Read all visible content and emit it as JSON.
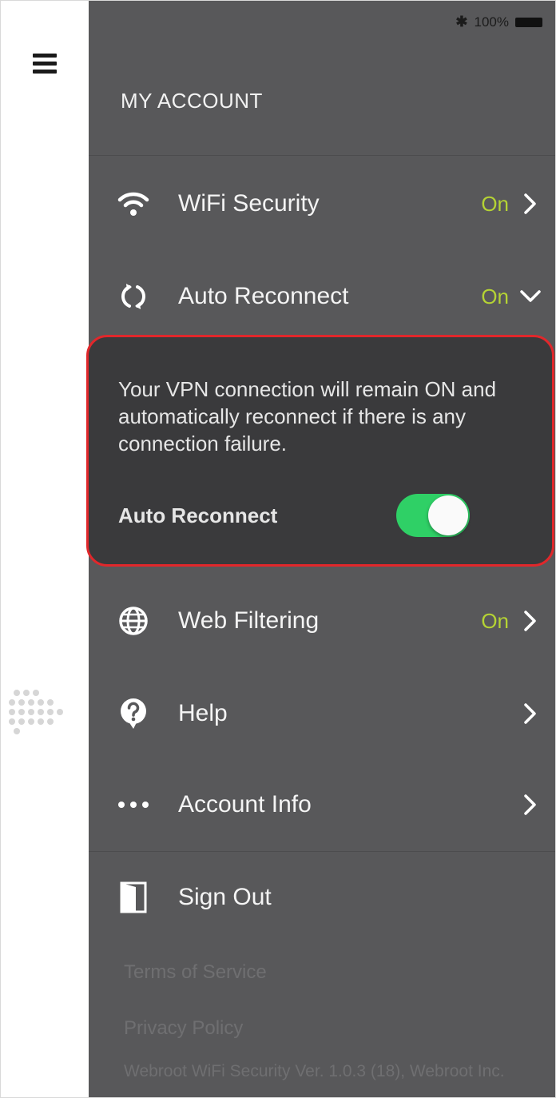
{
  "status_bar": {
    "bluetooth_symbol": "✱",
    "battery_text": "100%"
  },
  "menu": {
    "title": "MY ACCOUNT",
    "items": [
      {
        "icon": "wifi-icon",
        "label": "WiFi Security",
        "value": "On",
        "chevron": "right"
      },
      {
        "icon": "reconnect-icon",
        "label": "Auto Reconnect",
        "value": "On",
        "chevron": "down"
      },
      {
        "icon": "globe-icon",
        "label": "Web Filtering",
        "value": "On",
        "chevron": "right"
      },
      {
        "icon": "help-icon",
        "label": "Help",
        "value": "",
        "chevron": "right"
      },
      {
        "icon": "more-dots-icon",
        "label": "Account Info",
        "value": "",
        "chevron": "right"
      },
      {
        "icon": "sign-out-icon",
        "label": "Sign Out",
        "value": "",
        "chevron": ""
      }
    ]
  },
  "auto_reconnect_panel": {
    "description": "Your VPN connection will remain ON and automatically reconnect if there is any connection failure.",
    "toggle_label": "Auto Reconnect",
    "toggle_on": true
  },
  "footer": {
    "terms": "Terms of Service",
    "privacy": "Privacy Policy",
    "version": "Webroot WiFi Security Ver. 1.0.3 (18), Webroot Inc."
  },
  "colors": {
    "panel_bg": "#58585a",
    "expanded_bg": "#3a3a3c",
    "highlight_border": "#e1272b",
    "value_green": "#b5d334",
    "toggle_green": "#2fd066"
  }
}
